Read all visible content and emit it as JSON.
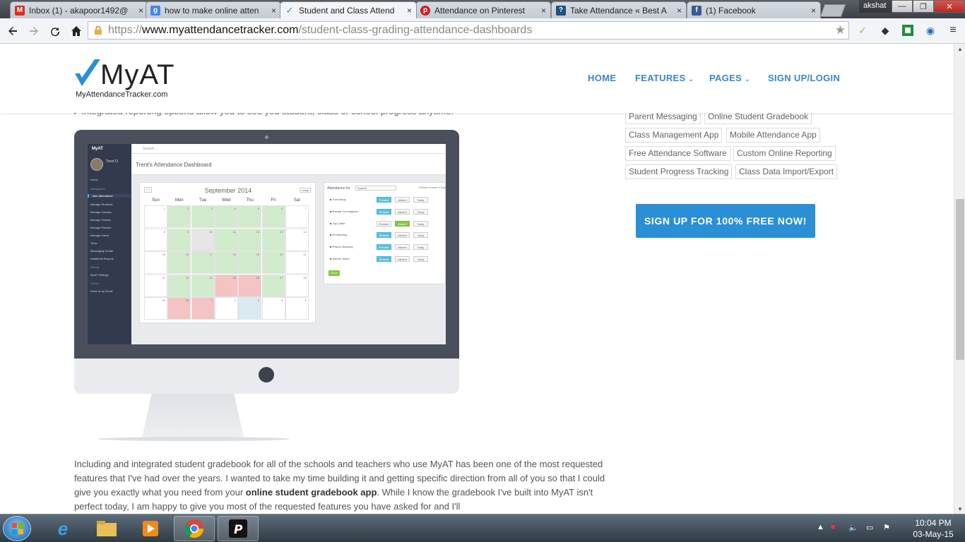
{
  "browser": {
    "tabs": [
      {
        "title": "Inbox (1) - akapoor1492@",
        "favicon": "gmail-icon"
      },
      {
        "title": "how to make online atten",
        "favicon": "google-icon"
      },
      {
        "title": "Student and Class Attend",
        "favicon": "myat-icon"
      },
      {
        "title": "Attendance on Pinterest",
        "favicon": "pinterest-icon"
      },
      {
        "title": "Take Attendance « Best A",
        "favicon": "site-icon"
      },
      {
        "title": "(1) Facebook",
        "favicon": "facebook-icon"
      }
    ],
    "tab_close": "×",
    "user": "akshat",
    "url": {
      "protocol": "https://",
      "host": "www.myattendancetracker.com",
      "path": "/student-class-grading-attendance-dashboards"
    }
  },
  "site": {
    "logo_text": "MyAT",
    "logo_sub": "MyAttendanceTracker.com",
    "nav": [
      {
        "label": "HOME",
        "dropdown": false
      },
      {
        "label": "FEATURES",
        "dropdown": true
      },
      {
        "label": "PAGES",
        "dropdown": true
      },
      {
        "label": "SIGN UP/LOGIN",
        "dropdown": false
      }
    ],
    "accent_color": "#3a86c8"
  },
  "article": {
    "cut_line": "Integrated reporting options allow you to see you student, class or school progress anytime.",
    "paragraph_1": "Including and integrated student gradebook for all of the schools and teachers who use MyAT has been one of the most requested features that I've had over the years. I wanted to take my time building it and getting specific direction from all of you so that I could give you exactly what you need from your ",
    "paragraph_bold": "online student gradebook app",
    "paragraph_2": ". While I know the gradebook I've built into MyAT isn't perfect today, I am happy to give you most of the requested features you have asked for and I'll"
  },
  "dashboard": {
    "brand": "MyAT",
    "user": "Trent O.",
    "search": "Search...",
    "title": "Trent's Attendance Dashboard",
    "sidebar": [
      "Home",
      "Management",
      "Take Attendance",
      "Manage Students",
      "Manage Classes",
      "Manage Grades",
      "Manage Parents",
      "Manage Users",
      "Tools",
      "Messaging Center",
      "Additional Reports",
      "Settings",
      "MyAT Settings",
      "Contact",
      "Send us an Email"
    ],
    "calendar": {
      "month": "September 2014",
      "today": "today",
      "days": [
        "Sun",
        "Mon",
        "Tue",
        "Wed",
        "Thu",
        "Fri",
        "Sat"
      ]
    },
    "attendance": {
      "label": "Attendance for",
      "class": "Speech",
      "choose": "Please choose a Day",
      "students": [
        {
          "name": "Tom Brady",
          "status": "Present"
        },
        {
          "name": "Randal Cunningham",
          "status": "Present"
        },
        {
          "name": "Jay Cutler",
          "status": "Absent"
        },
        {
          "name": "Eli Manning",
          "status": "Present"
        },
        {
          "name": "Peyton Manning",
          "status": "Present"
        },
        {
          "name": "Warren Moon",
          "status": "Present"
        }
      ],
      "buttons": [
        "Present",
        "Absent",
        "Tardy"
      ],
      "save": "Save"
    }
  },
  "sidebar_tags": [
    "Parent Messaging",
    "Online Student Gradebook",
    "Class Management App",
    "Mobile Attendance App",
    "Free Attendance Software",
    "Custom Online Reporting",
    "Student Progress Tracking",
    "Class Data Import/Export"
  ],
  "cta": {
    "label": "SIGN UP FOR 100% FREE NOW!",
    "color": "#2b8fd6"
  },
  "taskbar": {
    "apps": [
      "internet-explorer-icon",
      "file-explorer-icon",
      "media-player-icon",
      "chrome-icon",
      "pasco-icon"
    ],
    "time": "10:04 PM",
    "date": "03-May-15"
  }
}
